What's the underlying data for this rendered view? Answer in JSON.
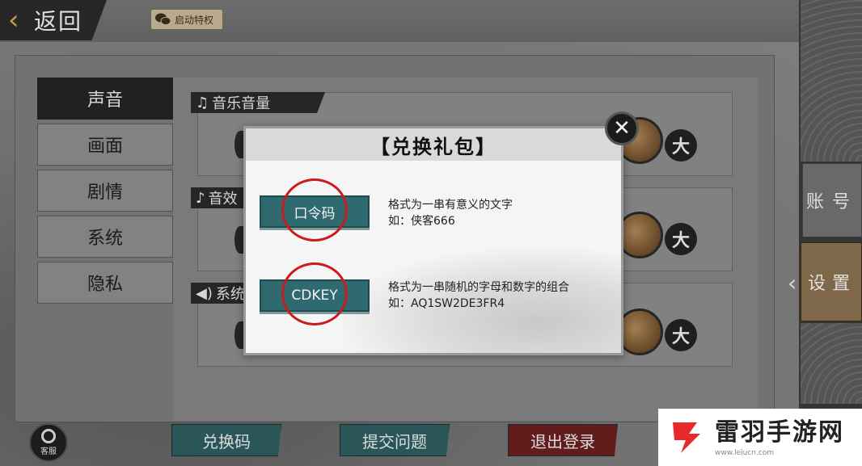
{
  "header": {
    "back_label": "返回",
    "privilege_label": "启动特权"
  },
  "tabs": [
    {
      "label": "声音",
      "active": true
    },
    {
      "label": "画面",
      "active": false
    },
    {
      "label": "剧情",
      "active": false
    },
    {
      "label": "系统",
      "active": false
    },
    {
      "label": "隐私",
      "active": false
    }
  ],
  "volume": {
    "music_label": "音乐音量",
    "sfx_label": "音效",
    "system_label": "系统",
    "max_label": "大"
  },
  "side_tabs": {
    "account": "账号",
    "settings": "设置"
  },
  "bottom": {
    "service_label": "客服",
    "redeem_label": "兑换码",
    "feedback_label": "提交问题",
    "logout_label": "退出登录"
  },
  "modal": {
    "title": "【兑换礼包】",
    "close_glyph": "✕",
    "passcode": {
      "button_label": "口令码",
      "desc_line1": "格式为一串有意义的文字",
      "desc_line2": "如：侠客666"
    },
    "cdkey": {
      "button_label": "CDKEY",
      "desc_line1": "格式为一串随机的字母和数字的组合",
      "desc_line2": "如：AQ1SW2DE3FR4"
    }
  },
  "watermark": {
    "title": "雷羽手游网",
    "url": "www.leiucn.com"
  },
  "colors": {
    "teal": "#2f6a70",
    "annotation_red": "#c91d1d",
    "logout_red": "#6b1f1f",
    "settings_tab": "#8a7150"
  }
}
